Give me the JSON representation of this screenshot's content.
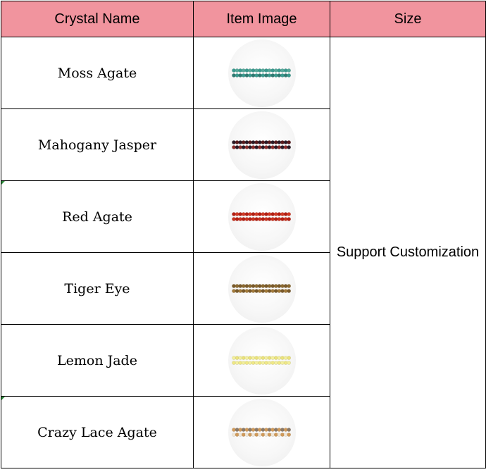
{
  "table": {
    "headers": {
      "name": "Crystal Name",
      "image": "Item Image",
      "size": "Size"
    },
    "header_color": "#f1949e",
    "size_value": "Support Customization",
    "rows": [
      {
        "name": "Moss Agate",
        "image": "moss-agate-bead-strand",
        "bead_colors": [
          "#3a9a8e",
          "#7cc7bd",
          "#2f7a72",
          "#a9d8cf",
          "#55a89a",
          "#e0efe9"
        ]
      },
      {
        "name": "Mahogany Jasper",
        "image": "mahogany-jasper-bead-strand",
        "bead_colors": [
          "#2a1a26",
          "#6e1f22",
          "#8a2a2a",
          "#1e1420",
          "#5a1a1c",
          "#3b2230"
        ]
      },
      {
        "name": "Red Agate",
        "image": "red-agate-bead-strand",
        "bead_colors": [
          "#b41e12",
          "#9c180e",
          "#c8301e",
          "#a81b10",
          "#d23a26",
          "#8e140a"
        ]
      },
      {
        "name": "Tiger Eye",
        "image": "tiger-eye-bead-strand",
        "bead_colors": [
          "#7a5a2a",
          "#3a3040",
          "#a27a3a",
          "#2e2a36",
          "#8c6a30",
          "#c09050"
        ]
      },
      {
        "name": "Lemon Jade",
        "image": "lemon-jade-bead-strand",
        "bead_colors": [
          "#f3ef9c",
          "#fbf7b8",
          "#efe886",
          "#f7f2aa",
          "#eae27c",
          "#fffad0"
        ]
      },
      {
        "name": "Crazy Lace Agate",
        "image": "crazy-lace-agate-bead-strand",
        "bead_colors": [
          "#d09a5a",
          "#6a5a7a",
          "#f0e6d6",
          "#b06a4a",
          "#8a7a6a",
          "#e0b880"
        ]
      }
    ]
  }
}
